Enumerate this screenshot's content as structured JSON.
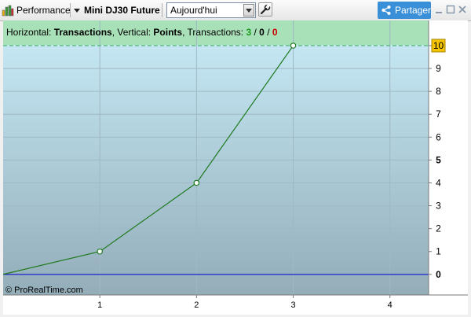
{
  "toolbar": {
    "performance_label": "Performance",
    "instrument_label": "Mini DJ30 Future",
    "period_select_value": "Aujourd'hui",
    "share_label": "Partager",
    "icons": {
      "performance": "bar-chart-icon",
      "instrument_menu": "triangle-down-icon",
      "settings": "wrench-icon",
      "share": "share-icon",
      "minimize": "minimize-icon",
      "maximize": "maximize-icon",
      "close": "close-icon"
    }
  },
  "info_bar": {
    "horizontal_prefix": "Horizontal: ",
    "horizontal_value": "Transactions",
    "vertical_prefix": ", Vertical: ",
    "vertical_value": "Points",
    "transactions_prefix": ", Transactions: ",
    "count_win": "3",
    "slash1": " / ",
    "count_neutral": "0",
    "slash2": " / ",
    "count_loss": "0"
  },
  "copyright": "© ProRealTime.com",
  "colors": {
    "line": "#1e7a1e",
    "zero_line": "#0000cc",
    "win": "#1a9a1a",
    "loss": "#cc0000",
    "highlight_label": "#f5c400",
    "info_bar_bg": "#a8e0b8"
  },
  "chart_data": {
    "type": "line",
    "x": [
      0,
      1,
      2,
      3
    ],
    "y": [
      0,
      1,
      4,
      10
    ],
    "xlim": [
      0,
      4.4
    ],
    "ylim": [
      -0.9,
      11.1
    ],
    "x_ticks": [
      1,
      2,
      3,
      4
    ],
    "y_ticks": [
      0,
      1,
      2,
      3,
      4,
      5,
      6,
      7,
      8,
      9,
      10
    ],
    "y_bold_ticks": [
      0,
      5
    ],
    "highlight_value": 10,
    "grid": true
  }
}
